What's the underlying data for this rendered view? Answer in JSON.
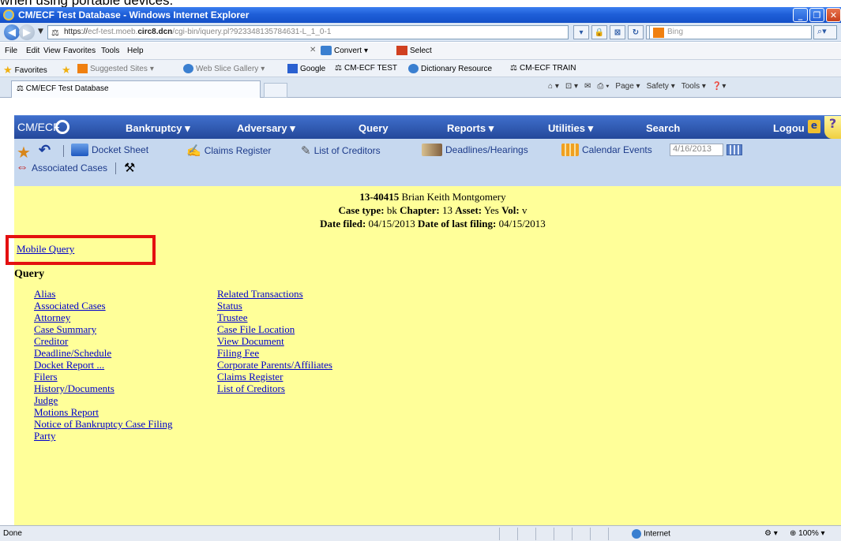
{
  "caption": "when using portable devices.",
  "window": {
    "title": "CM/ECF Test Database - Windows Internet Explorer"
  },
  "address": {
    "url_scheme": "https://",
    "url_pre": "ecf-test.moeb.",
    "url_host": "circ8.dcn",
    "url_path": "/cgi-bin/iquery.pl?923348135784631-L_1_0-1",
    "search_placeholder": "Bing"
  },
  "menu": {
    "items": [
      "File",
      "Edit",
      "View",
      "Favorites",
      "Tools",
      "Help"
    ],
    "convert": "Convert",
    "select": "Select"
  },
  "favorites": {
    "label": "Favorites",
    "suggested": "Suggested Sites",
    "webslice": "Web Slice Gallery",
    "google": "Google",
    "cmecf_test": "CM-ECF TEST",
    "dictionary": "Dictionary Resource",
    "cmecf_train": "CM-ECF TRAIN"
  },
  "tab": {
    "title": "CM/ECF Test Database"
  },
  "commandbar": {
    "page": "Page",
    "safety": "Safety",
    "tools": "Tools"
  },
  "ecf_nav": {
    "logo": "CM/ECF",
    "bankruptcy": "Bankruptcy",
    "adversary": "Adversary",
    "query": "Query",
    "reports": "Reports",
    "utilities": "Utilities",
    "search": "Search",
    "logout": "Logou"
  },
  "toolbar": {
    "docket_sheet": "Docket Sheet",
    "claims_register": "Claims Register",
    "list_of_creditors": "List of Creditors",
    "deadlines": "Deadlines/Hearings",
    "calendar_events": "Calendar Events",
    "calendar_date": "4/16/2013",
    "associated_cases": "Associated Cases"
  },
  "case": {
    "number": "13-40415",
    "name": "Brian Keith Montgomery",
    "type_label": "Case type:",
    "type": "bk",
    "chapter_label": "Chapter:",
    "chapter": "13",
    "asset_label": "Asset:",
    "asset": "Yes",
    "vol_label": "Vol:",
    "vol": "v",
    "filed_label": "Date filed:",
    "filed": "04/15/2013",
    "last_label": "Date of last filing:",
    "last": "04/15/2013"
  },
  "mobile_query": "Mobile Query",
  "query_title": "Query",
  "query_col1": [
    "Alias",
    "Associated Cases",
    "Attorney",
    "Case Summary",
    "Creditor",
    "Deadline/Schedule",
    "Docket Report ...",
    "Filers",
    "History/Documents",
    "Judge",
    "Motions Report",
    "Notice of Bankruptcy Case Filing",
    "Party"
  ],
  "query_col2": [
    "Related Transactions",
    "Status",
    "Trustee",
    "Case File Location",
    "View Document",
    "Filing Fee",
    "Corporate Parents/Affiliates",
    "Claims Register",
    "List of Creditors"
  ],
  "status": {
    "left": "Done",
    "zone": "Internet",
    "zoom": "100%"
  }
}
